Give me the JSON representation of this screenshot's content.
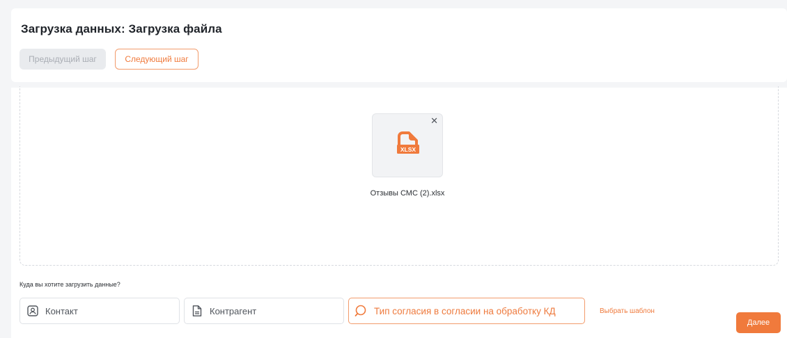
{
  "header": {
    "title": "Загрузка данных: Загрузка файла",
    "prev_label": "Предыдущий шаг",
    "next_label": "Следующий шаг"
  },
  "file": {
    "name": "Отзывы СМС (2).xlsx",
    "type_label": "XLSX",
    "close_glyph": "✕",
    "icon": "xlsx-file-icon"
  },
  "target": {
    "question": "Куда вы хотите загрузить данные?",
    "options": [
      {
        "label": "Контакт",
        "icon": "contact-icon"
      },
      {
        "label": "Контрагент",
        "icon": "document-icon"
      },
      {
        "label": "Тип согласия в согласии на обработку КД",
        "icon": "search-icon"
      }
    ],
    "template_link": "Выбрать шаблон",
    "next_button": "Далее"
  },
  "colors": {
    "accent": "#f07a3c",
    "border": "#dfe2e6",
    "disabled_bg": "#e9ebee"
  }
}
